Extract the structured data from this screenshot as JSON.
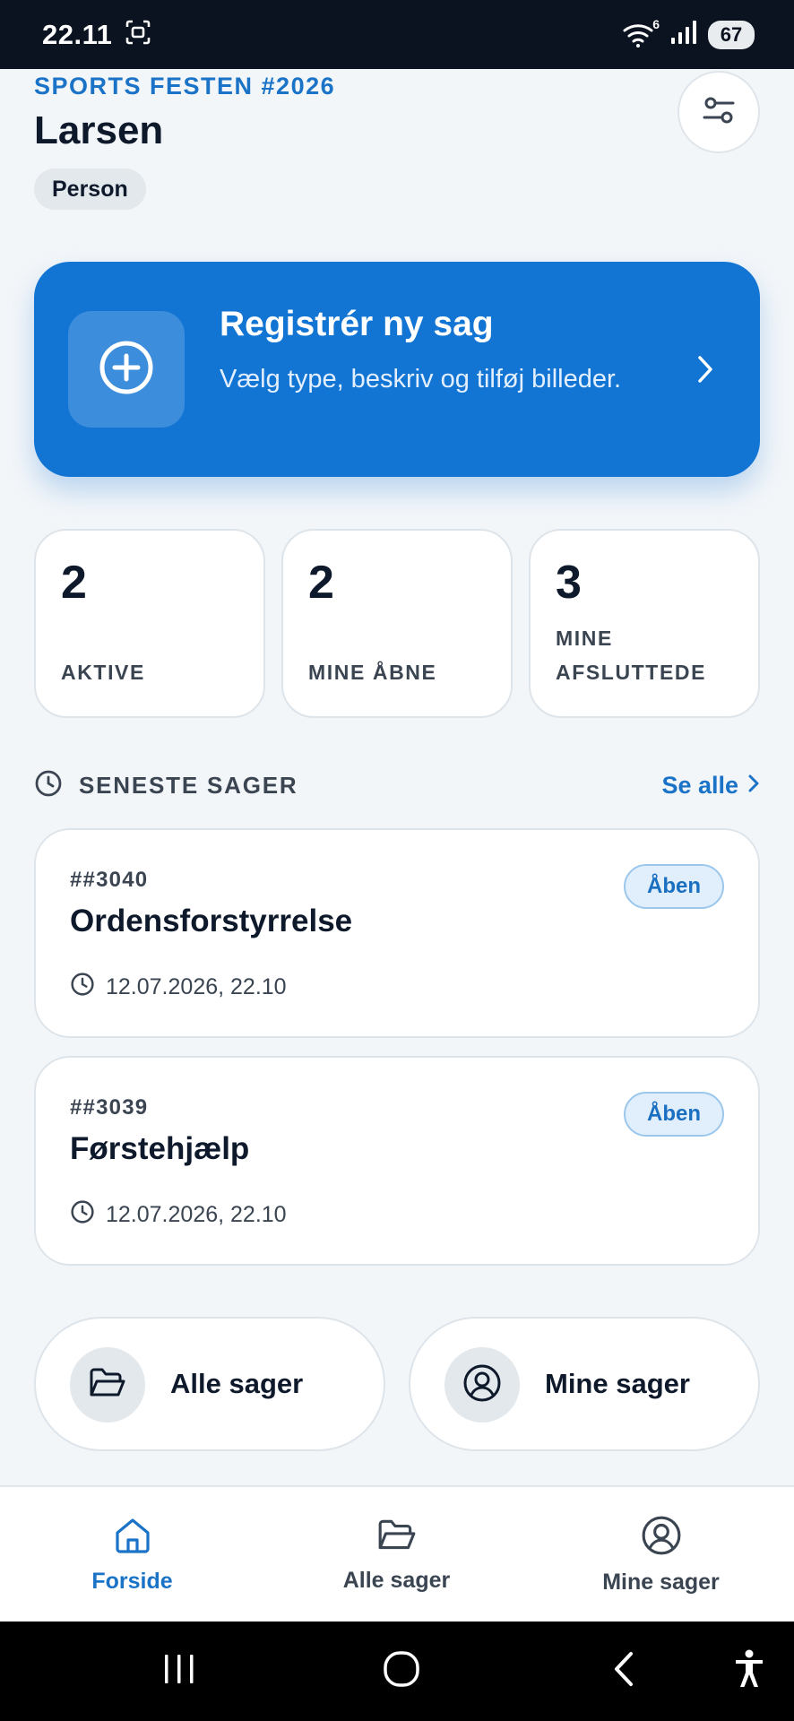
{
  "status_bar": {
    "time": "22.11",
    "battery": "67",
    "wifi_badge": "6",
    "icons": [
      "screenshot-icon",
      "wifi-icon",
      "signal-icon",
      "battery-icon"
    ]
  },
  "header": {
    "event_name": "SPORTS FESTEN #2026",
    "user_name": "Larsen",
    "role": "Person",
    "filter_icon": "sliders-icon"
  },
  "register_card": {
    "title": "Registrér ny sag",
    "subtitle": "Vælg type, beskriv og tilføj billeder.",
    "icon": "plus-circle-icon"
  },
  "stats": [
    {
      "value": "2",
      "label": "AKTIVE"
    },
    {
      "value": "2",
      "label": "MINE ÅBNE"
    },
    {
      "value": "3",
      "label": "MINE AFSLUTTEDE"
    }
  ],
  "recent": {
    "title": "SENESTE SAGER",
    "see_all": "Se alle",
    "cases": [
      {
        "id": "##3040",
        "title": "Ordensforstyrrelse",
        "time": "12.07.2026, 22.10",
        "status": "Åben"
      },
      {
        "id": "##3039",
        "title": "Førstehjælp",
        "time": "12.07.2026, 22.10",
        "status": "Åben"
      }
    ]
  },
  "quick_links": [
    {
      "label": "Alle sager",
      "icon": "folder-open-icon"
    },
    {
      "label": "Mine sager",
      "icon": "user-circle-icon"
    }
  ],
  "bottom_nav": [
    {
      "label": "Forside",
      "icon": "home-icon",
      "active": true
    },
    {
      "label": "Alle sager",
      "icon": "folder-open-icon",
      "active": false
    },
    {
      "label": "Mine sager",
      "icon": "user-circle-icon",
      "active": false
    }
  ],
  "colors": {
    "accent": "#1275d4",
    "link": "#1a73c7",
    "background": "#f3f6f9",
    "status_badge_bg": "#e0effb"
  }
}
